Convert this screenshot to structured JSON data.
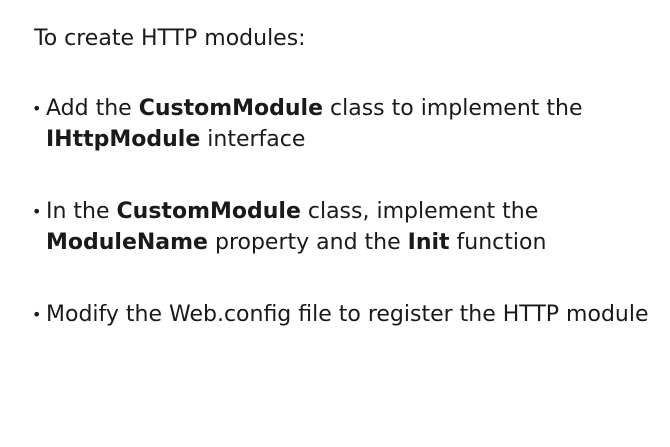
{
  "intro": "To create HTTP modules:",
  "bullet_symbol": "•",
  "bullets": [
    {
      "parts": [
        {
          "text": "Add the ",
          "bold": false
        },
        {
          "text": "CustomModule",
          "bold": true
        },
        {
          "text": " class to implement the ",
          "bold": false
        },
        {
          "text": "IHttpModule",
          "bold": true
        },
        {
          "text": " interface",
          "bold": false
        }
      ]
    },
    {
      "parts": [
        {
          "text": "In the ",
          "bold": false
        },
        {
          "text": "CustomModule",
          "bold": true
        },
        {
          "text": " class, implement the ",
          "bold": false
        },
        {
          "text": "ModuleName",
          "bold": true
        },
        {
          "text": " property and the ",
          "bold": false
        },
        {
          "text": "Init",
          "bold": true
        },
        {
          "text": " function",
          "bold": false
        }
      ]
    },
    {
      "parts": [
        {
          "text": "Modify the Web.config file to register the HTTP module",
          "bold": false
        }
      ]
    }
  ]
}
